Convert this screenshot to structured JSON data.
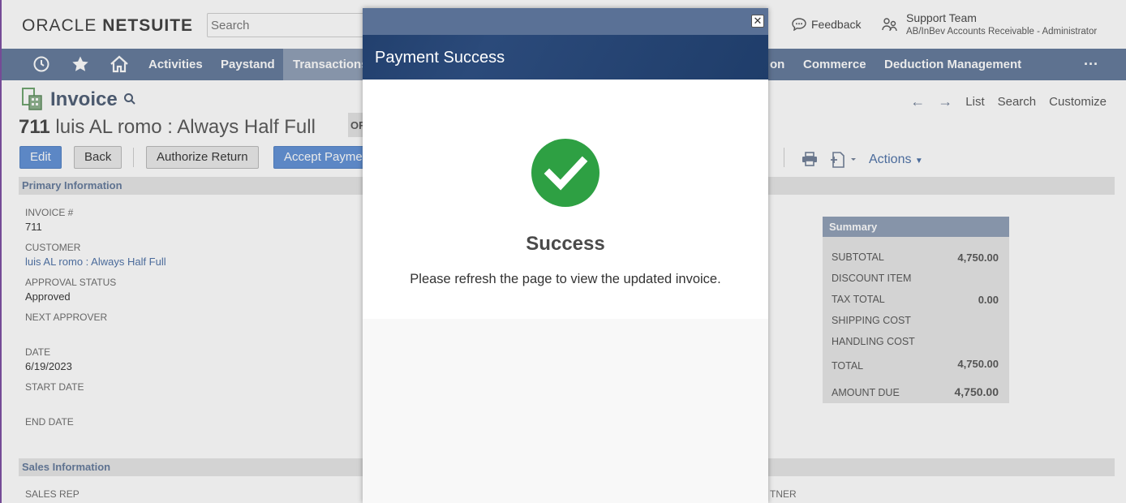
{
  "header": {
    "logo_brand": "ORACLE",
    "logo_product": "NETSUITE",
    "search_placeholder": "Search",
    "feedback_label": "Feedback",
    "user_name": "Support Team",
    "user_role": "AB/InBev Accounts Receivable - Administrator"
  },
  "nav": {
    "items": [
      "Activities",
      "Paystand",
      "Transactions",
      "on",
      "Commerce",
      "Deduction Management"
    ],
    "active": "Transactions",
    "more_label": "···"
  },
  "page": {
    "title": "Invoice",
    "record_number": "711",
    "record_name": "luis AL romo : Always Half Full",
    "status_chip": "OF",
    "right_links": [
      "List",
      "Search",
      "Customize"
    ],
    "buttons": {
      "edit": "Edit",
      "back": "Back",
      "authorize_return": "Authorize Return",
      "accept_payment": "Accept Paymen"
    },
    "actions_label": "Actions",
    "primary_section": "Primary Information",
    "sales_section": "Sales Information",
    "fields": {
      "invoice_label": "INVOICE #",
      "invoice_value": "711",
      "customer_label": "CUSTOMER",
      "customer_value": "luis AL romo : Always Half Full",
      "approval_label": "APPROVAL STATUS",
      "approval_value": "Approved",
      "next_approver_label": "NEXT APPROVER",
      "date_label": "DATE",
      "date_value": "6/19/2023",
      "start_date_label": "START DATE",
      "end_date_label": "END DATE",
      "sales_rep_label": "SALES REP",
      "partner_label": "TNER"
    },
    "summary": {
      "title": "Summary",
      "subtotal_label": "SUBTOTAL",
      "subtotal_value": "4,750.00",
      "discount_label": "DISCOUNT ITEM",
      "tax_label": "TAX TOTAL",
      "tax_value": "0.00",
      "shipping_label": "SHIPPING COST",
      "handling_label": "HANDLING COST",
      "total_label": "TOTAL",
      "total_value": "4,750.00",
      "amount_due_label": "AMOUNT DUE",
      "amount_due_value": "4,750.00"
    }
  },
  "modal": {
    "title": "Payment Success",
    "close_glyph": "✕",
    "heading": "Success",
    "message": "Please refresh the page to view the updated invoice."
  },
  "colors": {
    "nav_bg": "#607799",
    "modal_header": "#22406e",
    "success_green": "#2ea043"
  }
}
